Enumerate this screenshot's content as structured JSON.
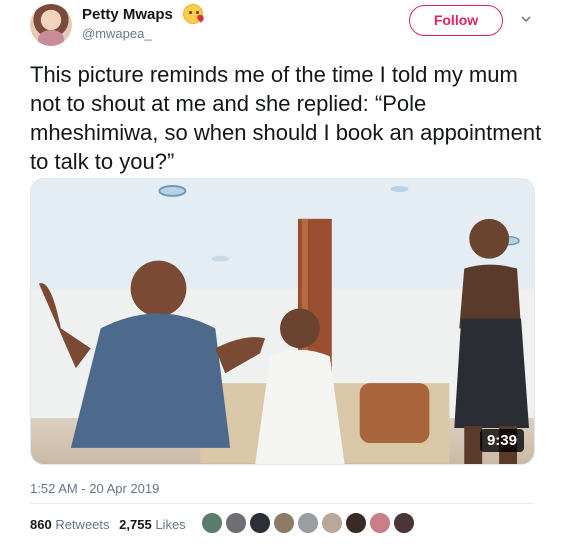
{
  "author": {
    "display_name": "Petty Mwaps",
    "handle": "@mwapea_",
    "emoji": "face-blowing-kiss-emoji"
  },
  "actions": {
    "follow_label": "Follow",
    "more_icon": "chevron-down-icon"
  },
  "tweet": {
    "text": "This picture reminds me of the time I told my mum not to shout at me and she replied: “Pole mheshimiwa, so when should I book an appointment to talk to you?”"
  },
  "media": {
    "duration": "9:39"
  },
  "meta": {
    "timestamp": "1:52 AM - 20 Apr 2019"
  },
  "stats": {
    "retweets_count": "860",
    "retweets_label": "Retweets",
    "likes_count": "2,755",
    "likes_label": "Likes"
  },
  "colors": {
    "follow_accent": "#e0245e",
    "secondary_text": "#657786"
  }
}
